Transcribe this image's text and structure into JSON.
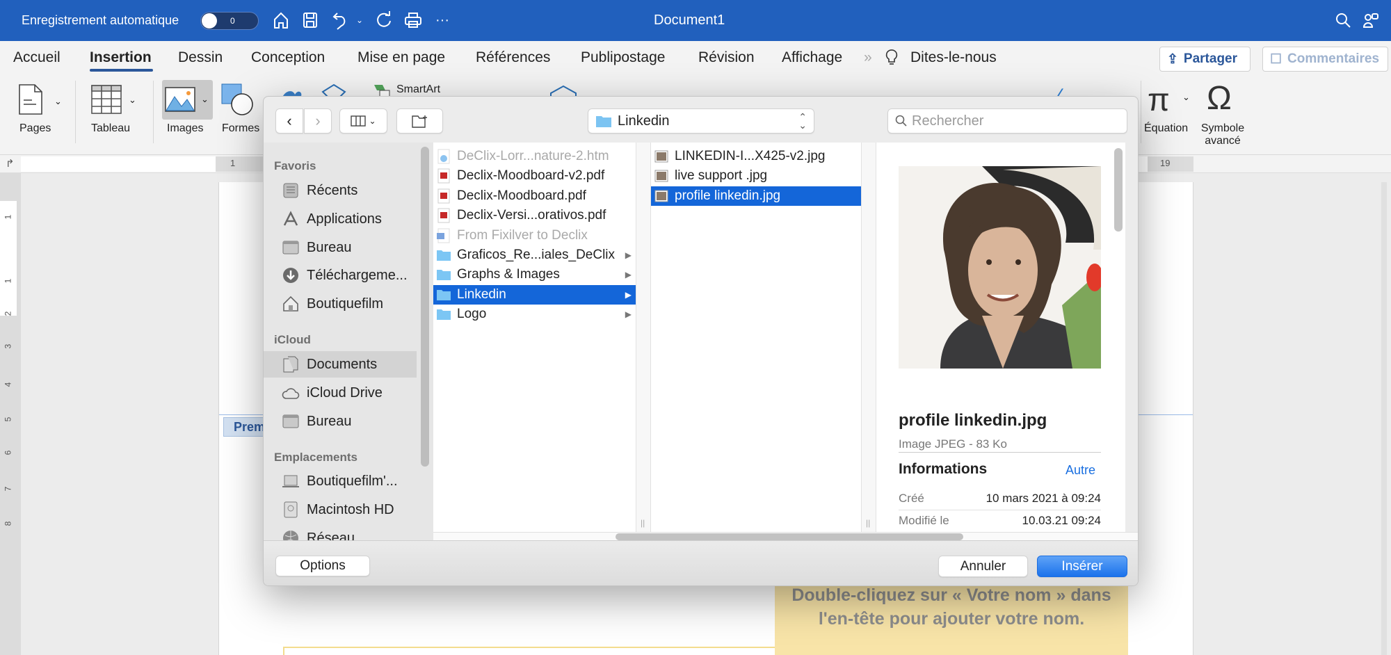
{
  "titlebar": {
    "autosave_label": "Enregistrement automatique",
    "autosave_state": "0",
    "title": "Document1"
  },
  "tabs": [
    "Accueil",
    "Insertion",
    "Dessin",
    "Conception",
    "Mise en page",
    "Références",
    "Publipostage",
    "Révision",
    "Affichage"
  ],
  "active_tab": "Insertion",
  "tell_me": "Dites-le-nous",
  "share_label": "Partager",
  "comments_label": "Commentaires",
  "ribbon": {
    "pages": "Pages",
    "table": "Tableau",
    "images": "Images",
    "shapes": "Formes",
    "smartart": "SmartArt",
    "equation": "Équation",
    "symbol": "Symbole avancé"
  },
  "ruler": {
    "h_start": "1",
    "h_end": "19",
    "v_numbers": [
      "1",
      "1",
      "2",
      "3",
      "4",
      "5",
      "6",
      "7",
      "8"
    ]
  },
  "document": {
    "header_tab": "Prem",
    "placeholder": "Double-cliquez sur « Votre nom » dans l'en-tête pour ajouter votre nom."
  },
  "dialog": {
    "path": "Linkedin",
    "search_placeholder": "Rechercher",
    "sidebar": [
      {
        "heading": "Favoris",
        "items": [
          {
            "label": "Récents",
            "icon": "recents-icon"
          },
          {
            "label": "Applications",
            "icon": "applications-icon"
          },
          {
            "label": "Bureau",
            "icon": "desktop-icon"
          },
          {
            "label": "Téléchargeme...",
            "icon": "downloads-icon"
          },
          {
            "label": "Boutiquefilm",
            "icon": "home-icon"
          }
        ]
      },
      {
        "heading": "iCloud",
        "items": [
          {
            "label": "Documents",
            "icon": "documents-icon",
            "selected": true
          },
          {
            "label": "iCloud Drive",
            "icon": "cloud-icon"
          },
          {
            "label": "Bureau",
            "icon": "desktop-icon"
          }
        ]
      },
      {
        "heading": "Emplacements",
        "items": [
          {
            "label": "Boutiquefilm'...",
            "icon": "laptop-icon"
          },
          {
            "label": "Macintosh HD",
            "icon": "hard-drive-icon"
          },
          {
            "label": "Réseau",
            "icon": "network-icon"
          }
        ]
      }
    ],
    "column1": [
      {
        "name": "DeClix-Lorr...nature-2.htm",
        "type": "htm",
        "dim": true
      },
      {
        "name": "Declix-Moodboard-v2.pdf",
        "type": "pdf"
      },
      {
        "name": "Declix-Moodboard.pdf",
        "type": "pdf"
      },
      {
        "name": "Declix-Versi...orativos.pdf",
        "type": "pdf"
      },
      {
        "name": "From Fixilver to Declix",
        "type": "word",
        "dim": true
      },
      {
        "name": "Graficos_Re...iales_DeClix",
        "type": "folder"
      },
      {
        "name": "Graphs & Images",
        "type": "folder"
      },
      {
        "name": "Linkedin",
        "type": "folder",
        "selected": true
      },
      {
        "name": "Logo",
        "type": "folder"
      }
    ],
    "column2": [
      {
        "name": "LINKEDIN-I...X425-v2.jpg",
        "type": "jpg"
      },
      {
        "name": "live support .jpg",
        "type": "jpg"
      },
      {
        "name": "profile linkedin.jpg",
        "type": "jpg",
        "selected": true
      }
    ],
    "preview": {
      "name": "profile linkedin.jpg",
      "kind": "Image JPEG - 83 Ko",
      "info_heading": "Informations",
      "more_link": "Autre",
      "created_label": "Créé",
      "created_value": "10 mars 2021 à 09:24",
      "modified_label": "Modifié le",
      "modified_value": "10.03.21 09:24"
    },
    "options_label": "Options",
    "cancel_label": "Annuler",
    "insert_label": "Insérer"
  },
  "colors": {
    "titlebar": "#2160bd",
    "selection": "#1466d9",
    "accent_link": "#1a6fe0",
    "placeholder_box": "#f8e4a8"
  }
}
